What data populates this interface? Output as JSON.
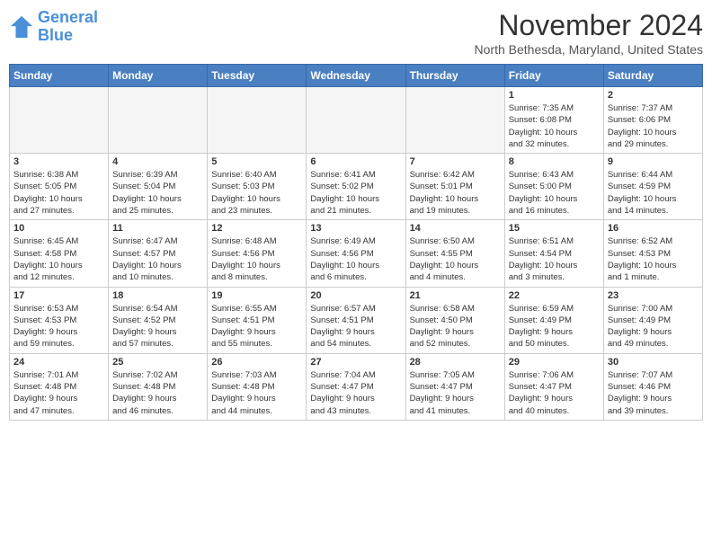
{
  "logo": {
    "line1": "General",
    "line2": "Blue"
  },
  "header": {
    "month": "November 2024",
    "location": "North Bethesda, Maryland, United States"
  },
  "weekdays": [
    "Sunday",
    "Monday",
    "Tuesday",
    "Wednesday",
    "Thursday",
    "Friday",
    "Saturday"
  ],
  "weeks": [
    [
      {
        "day": "",
        "info": "",
        "empty": true
      },
      {
        "day": "",
        "info": "",
        "empty": true
      },
      {
        "day": "",
        "info": "",
        "empty": true
      },
      {
        "day": "",
        "info": "",
        "empty": true
      },
      {
        "day": "",
        "info": "",
        "empty": true
      },
      {
        "day": "1",
        "info": "Sunrise: 7:35 AM\nSunset: 6:08 PM\nDaylight: 10 hours\nand 32 minutes."
      },
      {
        "day": "2",
        "info": "Sunrise: 7:37 AM\nSunset: 6:06 PM\nDaylight: 10 hours\nand 29 minutes."
      }
    ],
    [
      {
        "day": "3",
        "info": "Sunrise: 6:38 AM\nSunset: 5:05 PM\nDaylight: 10 hours\nand 27 minutes."
      },
      {
        "day": "4",
        "info": "Sunrise: 6:39 AM\nSunset: 5:04 PM\nDaylight: 10 hours\nand 25 minutes."
      },
      {
        "day": "5",
        "info": "Sunrise: 6:40 AM\nSunset: 5:03 PM\nDaylight: 10 hours\nand 23 minutes."
      },
      {
        "day": "6",
        "info": "Sunrise: 6:41 AM\nSunset: 5:02 PM\nDaylight: 10 hours\nand 21 minutes."
      },
      {
        "day": "7",
        "info": "Sunrise: 6:42 AM\nSunset: 5:01 PM\nDaylight: 10 hours\nand 19 minutes."
      },
      {
        "day": "8",
        "info": "Sunrise: 6:43 AM\nSunset: 5:00 PM\nDaylight: 10 hours\nand 16 minutes."
      },
      {
        "day": "9",
        "info": "Sunrise: 6:44 AM\nSunset: 4:59 PM\nDaylight: 10 hours\nand 14 minutes."
      }
    ],
    [
      {
        "day": "10",
        "info": "Sunrise: 6:45 AM\nSunset: 4:58 PM\nDaylight: 10 hours\nand 12 minutes."
      },
      {
        "day": "11",
        "info": "Sunrise: 6:47 AM\nSunset: 4:57 PM\nDaylight: 10 hours\nand 10 minutes."
      },
      {
        "day": "12",
        "info": "Sunrise: 6:48 AM\nSunset: 4:56 PM\nDaylight: 10 hours\nand 8 minutes."
      },
      {
        "day": "13",
        "info": "Sunrise: 6:49 AM\nSunset: 4:56 PM\nDaylight: 10 hours\nand 6 minutes."
      },
      {
        "day": "14",
        "info": "Sunrise: 6:50 AM\nSunset: 4:55 PM\nDaylight: 10 hours\nand 4 minutes."
      },
      {
        "day": "15",
        "info": "Sunrise: 6:51 AM\nSunset: 4:54 PM\nDaylight: 10 hours\nand 3 minutes."
      },
      {
        "day": "16",
        "info": "Sunrise: 6:52 AM\nSunset: 4:53 PM\nDaylight: 10 hours\nand 1 minute."
      }
    ],
    [
      {
        "day": "17",
        "info": "Sunrise: 6:53 AM\nSunset: 4:53 PM\nDaylight: 9 hours\nand 59 minutes."
      },
      {
        "day": "18",
        "info": "Sunrise: 6:54 AM\nSunset: 4:52 PM\nDaylight: 9 hours\nand 57 minutes."
      },
      {
        "day": "19",
        "info": "Sunrise: 6:55 AM\nSunset: 4:51 PM\nDaylight: 9 hours\nand 55 minutes."
      },
      {
        "day": "20",
        "info": "Sunrise: 6:57 AM\nSunset: 4:51 PM\nDaylight: 9 hours\nand 54 minutes."
      },
      {
        "day": "21",
        "info": "Sunrise: 6:58 AM\nSunset: 4:50 PM\nDaylight: 9 hours\nand 52 minutes."
      },
      {
        "day": "22",
        "info": "Sunrise: 6:59 AM\nSunset: 4:49 PM\nDaylight: 9 hours\nand 50 minutes."
      },
      {
        "day": "23",
        "info": "Sunrise: 7:00 AM\nSunset: 4:49 PM\nDaylight: 9 hours\nand 49 minutes."
      }
    ],
    [
      {
        "day": "24",
        "info": "Sunrise: 7:01 AM\nSunset: 4:48 PM\nDaylight: 9 hours\nand 47 minutes."
      },
      {
        "day": "25",
        "info": "Sunrise: 7:02 AM\nSunset: 4:48 PM\nDaylight: 9 hours\nand 46 minutes."
      },
      {
        "day": "26",
        "info": "Sunrise: 7:03 AM\nSunset: 4:48 PM\nDaylight: 9 hours\nand 44 minutes."
      },
      {
        "day": "27",
        "info": "Sunrise: 7:04 AM\nSunset: 4:47 PM\nDaylight: 9 hours\nand 43 minutes."
      },
      {
        "day": "28",
        "info": "Sunrise: 7:05 AM\nSunset: 4:47 PM\nDaylight: 9 hours\nand 41 minutes."
      },
      {
        "day": "29",
        "info": "Sunrise: 7:06 AM\nSunset: 4:47 PM\nDaylight: 9 hours\nand 40 minutes."
      },
      {
        "day": "30",
        "info": "Sunrise: 7:07 AM\nSunset: 4:46 PM\nDaylight: 9 hours\nand 39 minutes."
      }
    ]
  ]
}
